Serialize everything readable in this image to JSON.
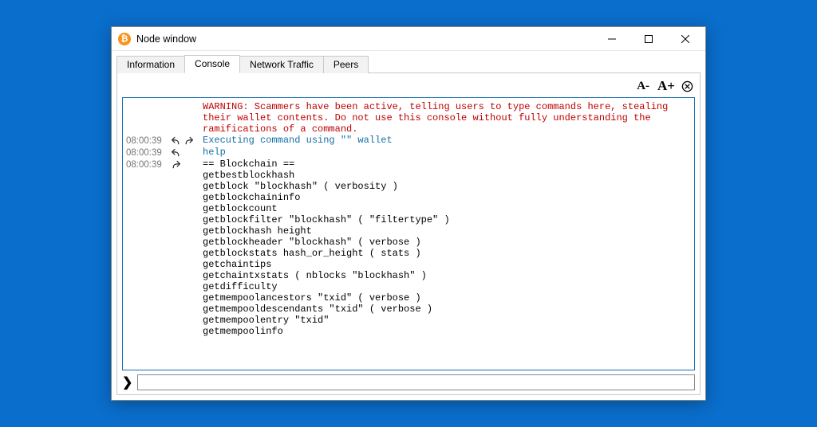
{
  "window": {
    "title": "Node window"
  },
  "tabs": [
    {
      "label": "Information"
    },
    {
      "label": "Console"
    },
    {
      "label": "Network Traffic"
    },
    {
      "label": "Peers"
    }
  ],
  "toolbar": {
    "font_smaller": "A-",
    "font_larger": "A+"
  },
  "console": {
    "warning": "WARNING: Scammers have been active, telling users to type commands here, stealing their wallet contents. Do not use this console without fully understanding the ramifications of a command.",
    "rows": [
      {
        "ts": "08:00:39",
        "icon": "out-in",
        "color": "blue",
        "text": "Executing command using \"\" wallet"
      },
      {
        "ts": "08:00:39",
        "icon": "out",
        "color": "blue",
        "text": "help"
      },
      {
        "ts": "08:00:39",
        "icon": "in",
        "color": "",
        "text": "== Blockchain ==\ngetbestblockhash\ngetblock \"blockhash\" ( verbosity )\ngetblockchaininfo\ngetblockcount\ngetblockfilter \"blockhash\" ( \"filtertype\" )\ngetblockhash height\ngetblockheader \"blockhash\" ( verbose )\ngetblockstats hash_or_height ( stats )\ngetchaintips\ngetchaintxstats ( nblocks \"blockhash\" )\ngetdifficulty\ngetmempoolancestors \"txid\" ( verbose )\ngetmempooldescendants \"txid\" ( verbose )\ngetmempoolentry \"txid\"\ngetmempoolinfo"
      }
    ]
  },
  "input": {
    "value": "",
    "placeholder": ""
  }
}
